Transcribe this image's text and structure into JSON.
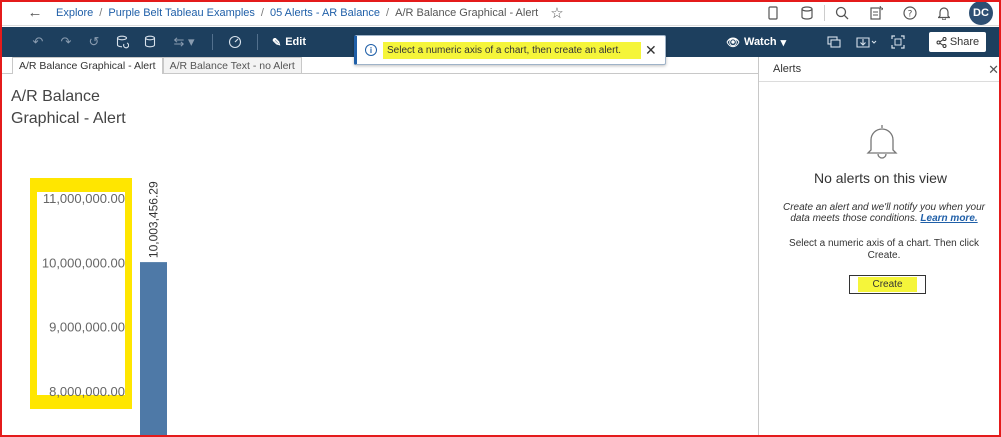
{
  "breadcrumb": {
    "items": [
      "Explore",
      "Purple Belt Tableau Examples",
      "05 Alerts - AR Balance"
    ],
    "current": "A/R Balance Graphical - Alert"
  },
  "user": {
    "initials": "DC"
  },
  "toolbar": {
    "edit_label": "Edit",
    "watch_label": "Watch",
    "share_label": "Share"
  },
  "notification": {
    "message": "Select a numeric axis of a chart, then create an alert."
  },
  "tabs": [
    {
      "label": "A/R Balance Graphical - Alert",
      "active": true
    },
    {
      "label": "A/R Balance Text - no Alert",
      "active": false
    }
  ],
  "viz": {
    "title": "A/R Balance Graphical - Alert"
  },
  "chart_data": {
    "type": "bar",
    "categories": [
      ""
    ],
    "values": [
      10003456.29
    ],
    "data_labels": [
      "10,003,456.29"
    ],
    "y_ticks": [
      "11,000,000.00",
      "10,000,000.00",
      "9,000,000.00",
      "8,000,000.00"
    ],
    "y_tick_values": [
      11000000,
      10000000,
      9000000,
      8000000
    ],
    "bar_color": "#4e79a7",
    "axis_highlight_color": "#ffe600"
  },
  "alerts_panel": {
    "title": "Alerts",
    "empty_title": "No alerts on this view",
    "description": "Create an alert and we'll notify you when your data meets those conditions.",
    "learn_more": "Learn more.",
    "instruction": "Select a numeric axis of a chart. Then click Create.",
    "create_label": "Create"
  },
  "colors": {
    "toolbar_bg": "#1d3f5e",
    "link": "#1f5fa8",
    "highlight": "#f5f53a",
    "frame": "#e41b1b"
  }
}
